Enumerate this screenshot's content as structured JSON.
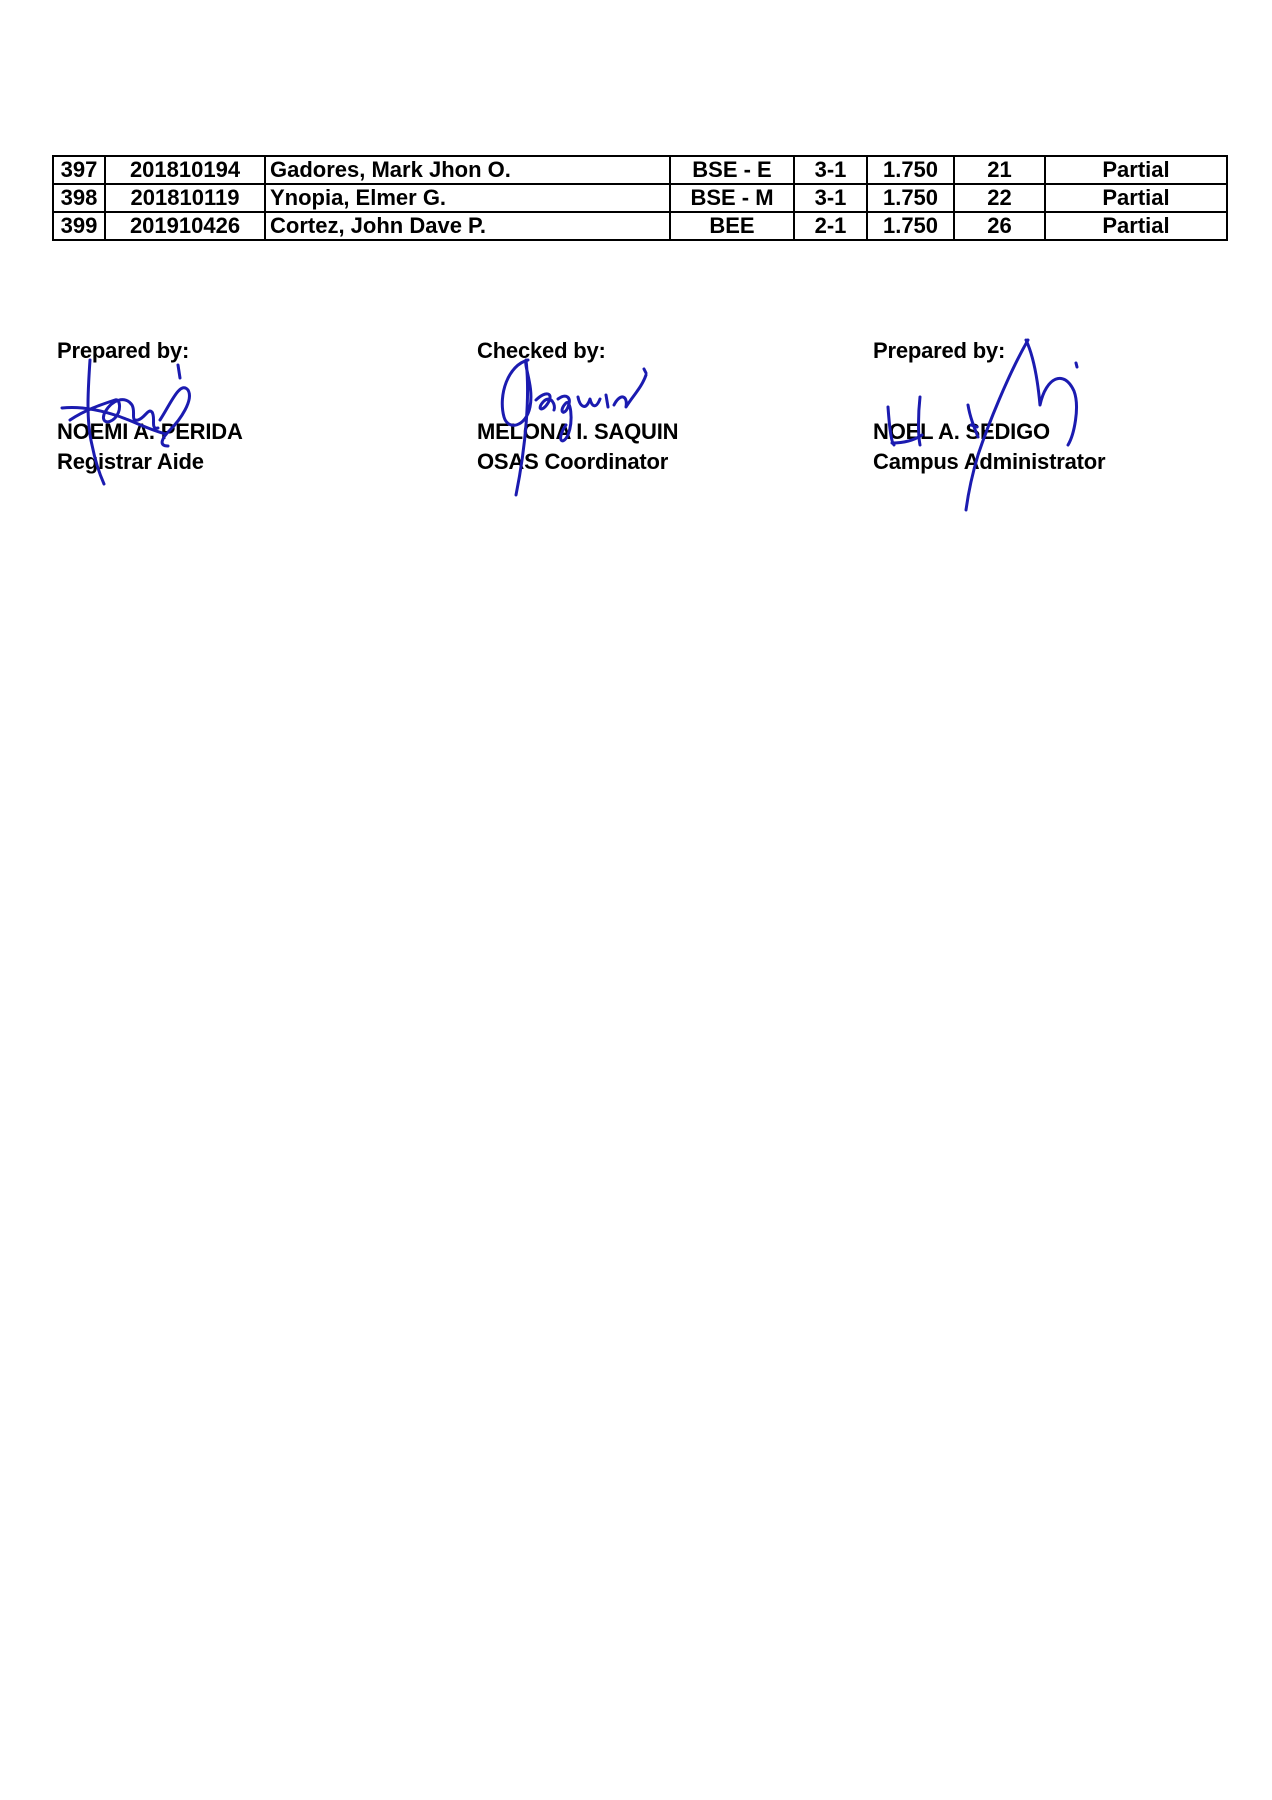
{
  "table": {
    "rows": [
      {
        "no": "397",
        "student_id": "201810194",
        "name": "Gadores, Mark Jhon O.",
        "program": "BSE - E",
        "year_sem": "3-1",
        "gpa": "1.750",
        "units": "21",
        "status": "Partial"
      },
      {
        "no": "398",
        "student_id": "201810119",
        "name": "Ynopia, Elmer G.",
        "program": "BSE - M",
        "year_sem": "3-1",
        "gpa": "1.750",
        "units": "22",
        "status": "Partial"
      },
      {
        "no": "399",
        "student_id": "201910426",
        "name": "Cortez, John Dave P.",
        "program": "BEE",
        "year_sem": "2-1",
        "gpa": "1.750",
        "units": "26",
        "status": "Partial"
      }
    ]
  },
  "signatories": {
    "prepared1": {
      "label": "Prepared by:",
      "name": "NOEMI A. PERIDA",
      "position": "Registrar Aide"
    },
    "checked": {
      "label": "Checked by:",
      "name": "MELONA I. SAQUIN",
      "position": "OSAS Coordinator"
    },
    "prepared2": {
      "label": "Prepared by:",
      "name": "NOEL A. SEDIGO",
      "position": "Campus Administrator"
    }
  },
  "colors": {
    "signature_ink": "#1b1bb0",
    "text": "#000000",
    "background": "#ffffff"
  }
}
